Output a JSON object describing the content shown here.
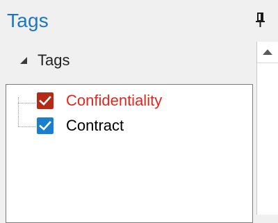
{
  "panel": {
    "title": "Tags"
  },
  "header": {
    "pin_icon": "pin-icon"
  },
  "section": {
    "label": "Tags",
    "expanded": true,
    "toggle_icon": "collapse-triangle-icon"
  },
  "tree": {
    "items": [
      {
        "label": "Confidentiality",
        "checked": true,
        "checkbox_color": "#b52a17",
        "text_color": "#e8251b"
      },
      {
        "label": "Contract",
        "checked": true,
        "checkbox_color": "#1b7fd0",
        "text_color": "#000000"
      }
    ]
  },
  "colors": {
    "accent": "#1c76c8",
    "background": "#f0f0f0"
  },
  "scrollbar": {
    "up_icon": "scroll-up-arrow-icon"
  }
}
